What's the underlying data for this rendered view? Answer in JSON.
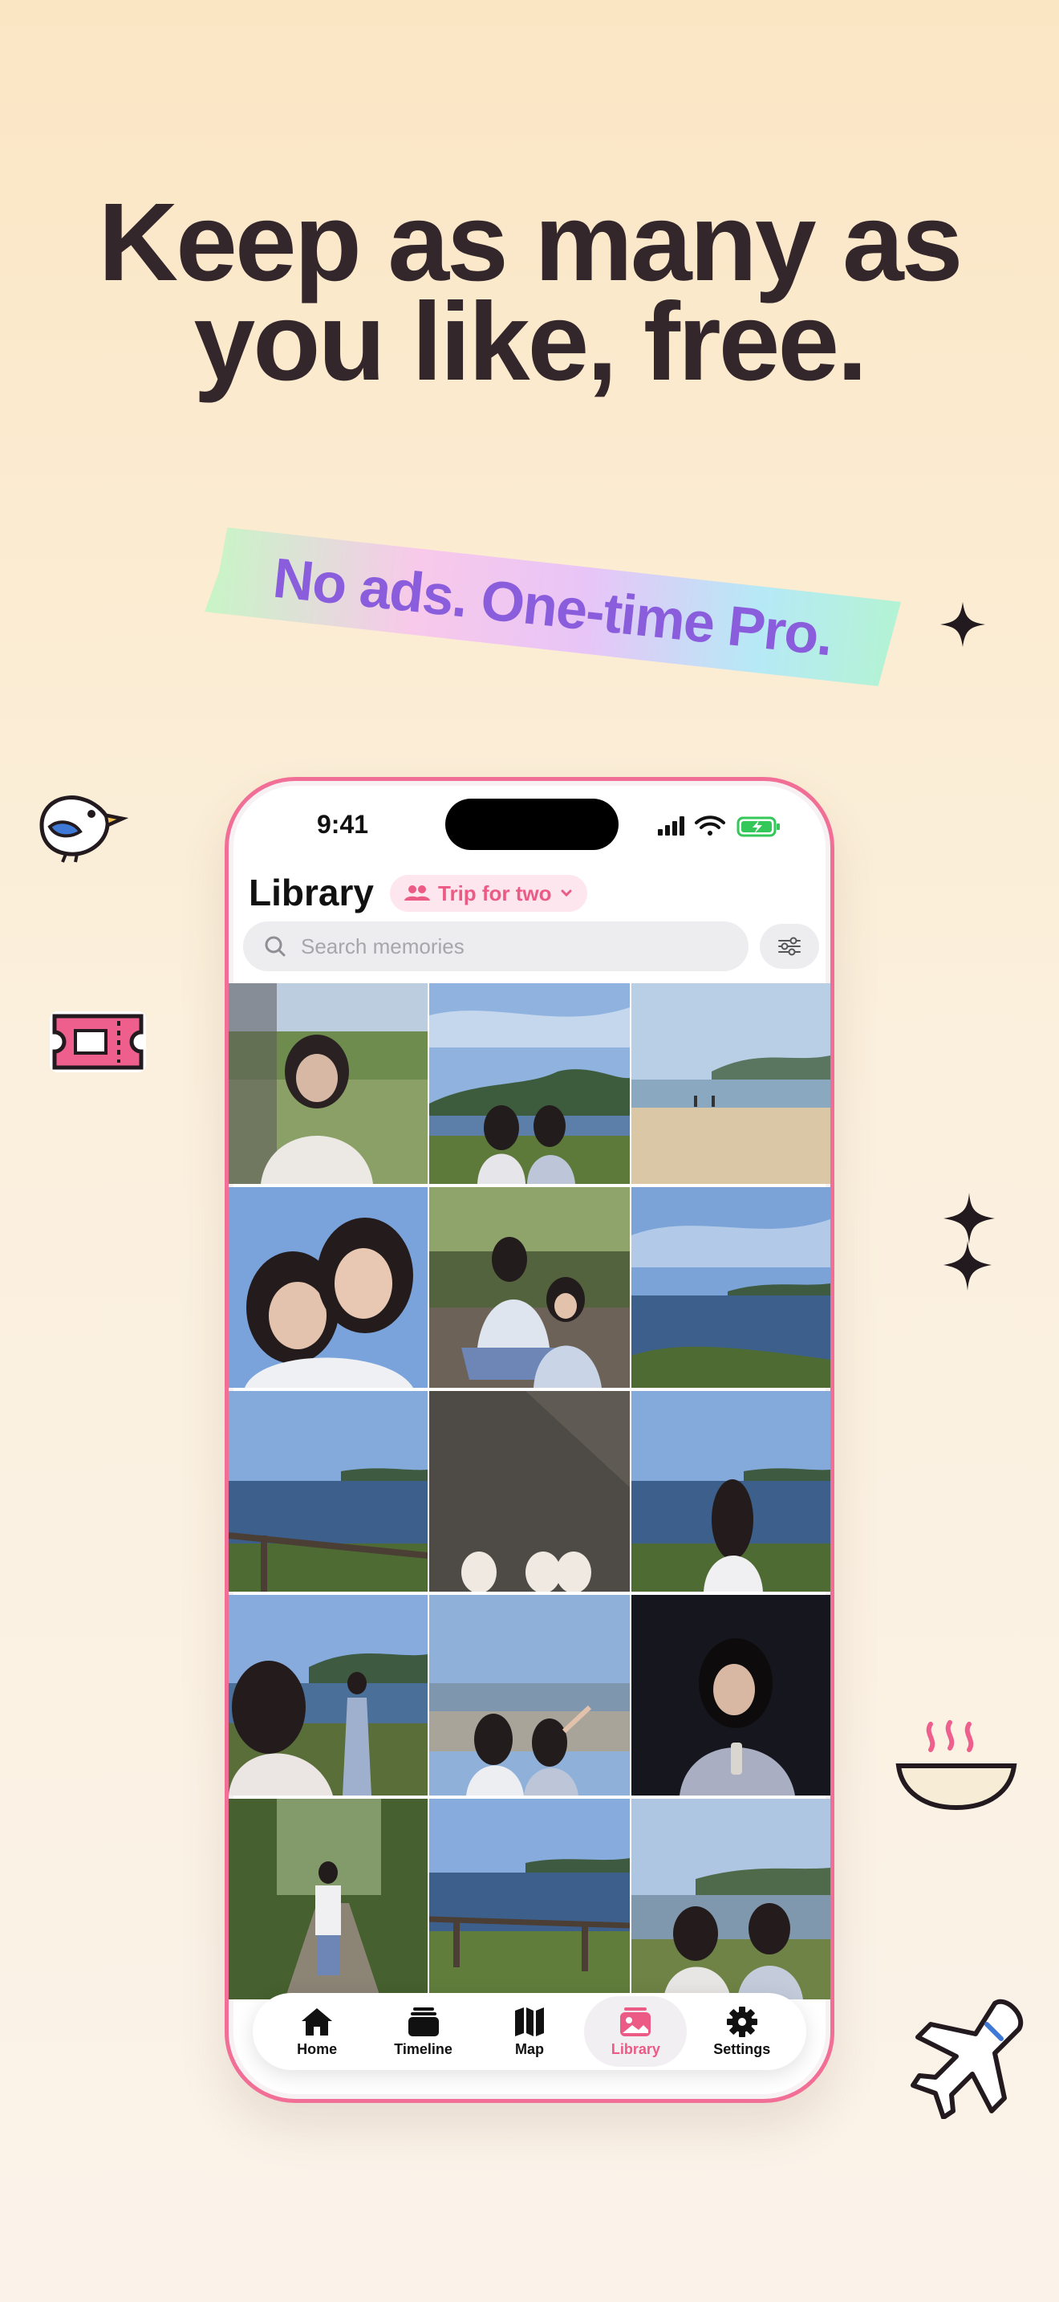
{
  "headline": {
    "line1": "Keep as many as",
    "line2": "you like, free."
  },
  "tape_text": "No ads. One-time Pro.",
  "colors": {
    "accent": "#ec5a86",
    "headline": "#33272c",
    "tape_text": "#8a5ddc"
  },
  "status_bar": {
    "time": "9:41",
    "icons": [
      "signal-icon",
      "wifi-icon",
      "battery-charging-icon"
    ]
  },
  "library": {
    "title": "Library",
    "album_chip": {
      "label": "Trip for two",
      "icon": "people-icon"
    },
    "search": {
      "placeholder": "Search memories"
    },
    "filter_icon": "sliders-icon",
    "photos": [
      {
        "desc": "girl portrait in car by green field"
      },
      {
        "desc": "two girls looking at coastal bay"
      },
      {
        "desc": "beach with people"
      },
      {
        "desc": "two girls selfie with blue sky"
      },
      {
        "desc": "two girls sitting in woods"
      },
      {
        "desc": "ocean view from cliff"
      },
      {
        "desc": "coastline with railing"
      },
      {
        "desc": "shoes on pavement"
      },
      {
        "desc": "girl looking at sea"
      },
      {
        "desc": "girl taking photo of friend"
      },
      {
        "desc": "two girls pointing at city view"
      },
      {
        "desc": "girl at night portrait"
      },
      {
        "desc": "girl walking on forest path"
      },
      {
        "desc": "coast with wooden fence"
      },
      {
        "desc": "two girls by the sea"
      }
    ]
  },
  "tabs": [
    {
      "label": "Home",
      "icon": "house-icon"
    },
    {
      "label": "Timeline",
      "icon": "stack-icon"
    },
    {
      "label": "Map",
      "icon": "map-icon"
    },
    {
      "label": "Library",
      "icon": "photo-icon",
      "active": true
    },
    {
      "label": "Settings",
      "icon": "gear-icon"
    }
  ]
}
